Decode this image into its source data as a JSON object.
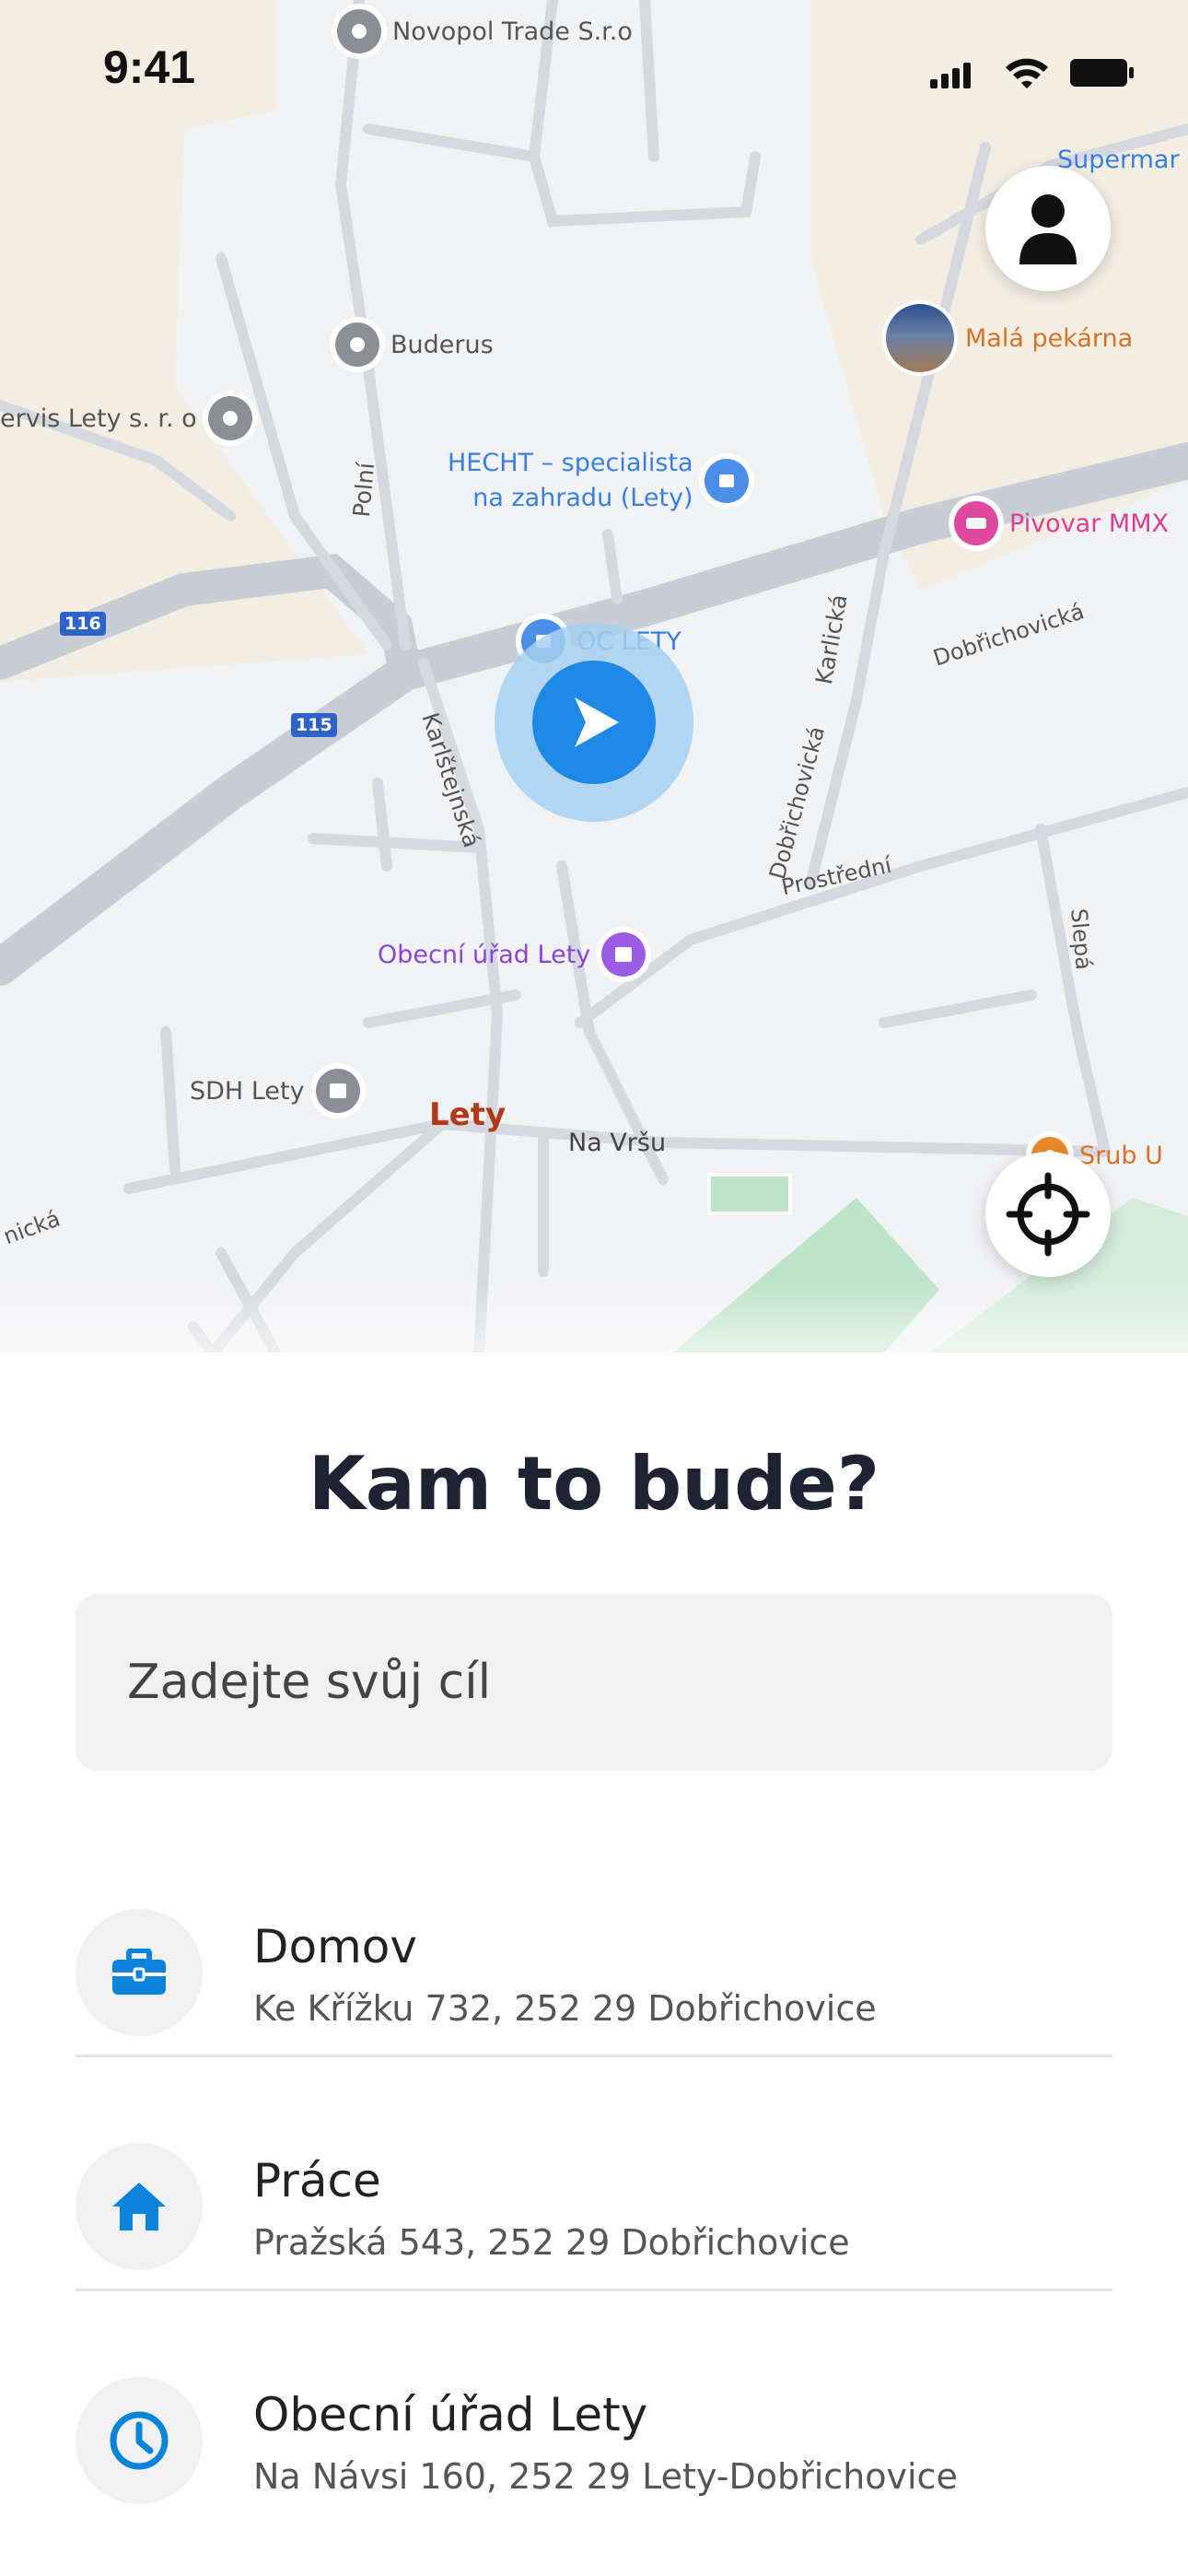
{
  "status_bar": {
    "time": "9:41"
  },
  "map": {
    "pois": [
      {
        "name": "Novopol Trade S.r.o",
        "style": "grey"
      },
      {
        "name": "Buderus",
        "style": "grey"
      },
      {
        "name": "ervis Lety s. r. o",
        "style": "grey"
      },
      {
        "name": "HECHT – specialista na zahradu (Lety)",
        "style": "blue"
      },
      {
        "name": "Supermar",
        "style": "blue"
      },
      {
        "name": "Malá pekárna",
        "style": "orange-photo"
      },
      {
        "name": "Pivovar MMX",
        "style": "pink"
      },
      {
        "name": "OC LETY",
        "style": "blue"
      },
      {
        "name": "Obecní úřad Lety",
        "style": "purple"
      },
      {
        "name": "SDH Lety",
        "style": "grey"
      },
      {
        "name": "Srub U",
        "style": "orange"
      }
    ],
    "hecht_line1": "HECHT – specialista",
    "hecht_line2": "na zahradu (Lety)",
    "town_label": "Lety",
    "streets": [
      "Polní",
      "Karlštejnská",
      "Karlická",
      "Dobřichovická",
      "Dobřichovická",
      "Prostřední",
      "Slepá",
      "Na Vršu",
      "nická"
    ],
    "road_numbers": [
      "116",
      "115"
    ],
    "colors": {
      "land": "#f1f2f4",
      "road": "#c9ced6",
      "built": "#f3eee2",
      "park": "#bfe5c8",
      "location": "#1e88e5",
      "location_halo": "#a7d0f0"
    }
  },
  "buttons": {
    "profile_icon": "person-icon",
    "locate_icon": "crosshair-icon"
  },
  "sheet": {
    "title": "Kam to bude?",
    "search_placeholder": "Zadejte svůj cíl",
    "places": [
      {
        "name": "Domov",
        "address": "Ke Křížku 732, 252 29 Dobřichovice",
        "icon": "briefcase-icon"
      },
      {
        "name": "Práce",
        "address": "Pražská 543, 252 29 Dobřichovice",
        "icon": "home-icon"
      },
      {
        "name": "Obecní úřad Lety",
        "address": "Na Návsi 160, 252 29 Lety-Dobřichovice",
        "icon": "clock-icon"
      }
    ],
    "accent_color": "#0a84d8"
  }
}
